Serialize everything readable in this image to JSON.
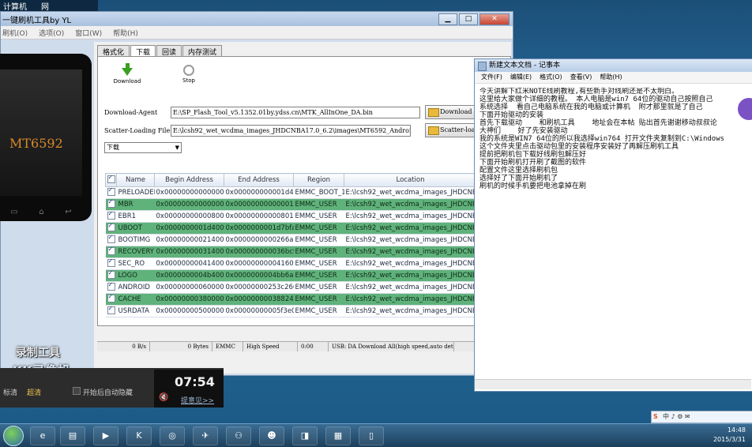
{
  "left_top_menu": [
    "计算机",
    "网"
  ],
  "flash_tool": {
    "title": "一键刷机工具by YL",
    "menu": [
      "刷机(O)",
      "选项(O)",
      "窗口(W)",
      "帮助(H)"
    ],
    "tabs": [
      "格式化",
      "下载",
      "回读",
      "内存测试"
    ],
    "active_tab": "下载",
    "download_btn": "Download",
    "stop_btn": "Stop",
    "download_agent_label": "Download-Agent",
    "download_agent_path": "E:\\SP_Flash_Tool_v5.1352.01by.ydss.cn\\MTK_AllInOne_DA.bin",
    "download_agent_btn": "Download Agent",
    "scatter_label": "Scatter-Loading File",
    "scatter_path": "E:\\lcsh92_wet_wcdma_images_JHDCNBA17.0_6.2\\images\\MT6592_Android_scatter.txt",
    "scatter_btn": "Scatter-loading",
    "mode_select": "下载",
    "table": {
      "headers": [
        "Name",
        "Begin Address",
        "End Address",
        "Region",
        "Location"
      ],
      "rows": [
        {
          "checked": true,
          "name": "PRELOADER",
          "begin": "0x0000000000000000",
          "end": "0x000000000001d453",
          "region": "EMMC_BOOT_1",
          "location": "E:\\lcsh92_wet_wcdma_images_JHDCNBA...",
          "style": "w"
        },
        {
          "checked": true,
          "name": "MBR",
          "begin": "0x0000000000000000",
          "end": "0x00000000000001ff",
          "region": "EMMC_USER",
          "location": "E:\\lcsh92_wet_wcdma_images_JHDCNBA...",
          "style": "g"
        },
        {
          "checked": true,
          "name": "EBR1",
          "begin": "0x0000000000080000",
          "end": "0x00000000000801ff",
          "region": "EMMC_USER",
          "location": "E:\\lcsh92_wet_wcdma_images_JHDCNBA...",
          "style": "w"
        },
        {
          "checked": true,
          "name": "UBOOT",
          "begin": "0x0000000001d40000",
          "end": "0x0000000001d7bfa3",
          "region": "EMMC_USER",
          "location": "E:\\lcsh92_wet_wcdma_images_JHDCNBA...",
          "style": "g"
        },
        {
          "checked": true,
          "name": "BOOTIMG",
          "begin": "0x0000000002140000",
          "end": "0x0000000000266a7ff",
          "region": "EMMC_USER",
          "location": "E:\\lcsh92_wet_wcdma_images_JHDCNBA...",
          "style": "w"
        },
        {
          "checked": true,
          "name": "RECOVERY",
          "begin": "0x0000000003140000",
          "end": "0x000000000036bcfff",
          "region": "EMMC_USER",
          "location": "E:\\lcsh92_wet_wcdma_images_JHDCNBA...",
          "style": "g"
        },
        {
          "checked": true,
          "name": "SEC_RO",
          "begin": "0x0000000004140000",
          "end": "0x00000000004160fff",
          "region": "EMMC_USER",
          "location": "E:\\lcsh92_wet_wcdma_images_JHDCNBA...",
          "style": "w"
        },
        {
          "checked": true,
          "name": "LOGO",
          "begin": "0x0000000004b40000",
          "end": "0x0000000004bb6a91",
          "region": "EMMC_USER",
          "location": "E:\\lcsh92_wet_wcdma_images_JHDCNBA...",
          "style": "g"
        },
        {
          "checked": true,
          "name": "ANDROID",
          "begin": "0x0000000006000000",
          "end": "0x00000000253c2663",
          "region": "EMMC_USER",
          "location": "E:\\lcsh92_wet_wcdma_images_JHDCNBA...",
          "style": "w"
        },
        {
          "checked": true,
          "name": "CACHE",
          "begin": "0x0000000038000000",
          "end": "0x000000000388240e7",
          "region": "EMMC_USER",
          "location": "E:\\lcsh92_wet_wcdma_images_JHDCNBA...",
          "style": "g"
        },
        {
          "checked": true,
          "name": "USRDATA",
          "begin": "0x0000000050000000",
          "end": "0x00000000005f3e0333",
          "region": "EMMC_USER",
          "location": "E:\\lcsh92_wet_wcdma_images_JHDCNBA...",
          "style": "w"
        }
      ]
    },
    "status": [
      "0 B/s",
      "0 Bytes",
      "EMMC",
      "High Speed",
      "0:00",
      "USB: DA Download All(high speed,auto detect)"
    ]
  },
  "phone": {
    "model_text": "MT6592"
  },
  "recorder": {
    "logo_line1": "录制工具",
    "logo_line2": "KK录像机",
    "label_a": "标清",
    "label_b": "超清",
    "checkbox_label": "开始后自动隐藏",
    "time": "07:54",
    "hint": "提意见>>"
  },
  "notepad": {
    "title": "新建文本文档 - 记事本",
    "menu": [
      "文件(F)",
      "编辑(E)",
      "格式(O)",
      "查看(V)",
      "帮助(H)"
    ],
    "text": "今天讲解下红米NOTE线刷教程,有些新手对线刷还是不太明白。\n这里给大家做个详细的教程。 本人电脑是win7 64位的驱动自己按照自己\n系统选择  看自己电脑系统在我的电脑或计算机  附才那里就是了自己\n下面开始驱动的安装\n首先下载驱动    和刷机工具    地址会在本帖 贴出首先谢谢移动叔叔论\n大神们    好了先安装驱动\n我的系统是WIN7 64位的所以我选择win764 打开文件夹复制到C:\\Windows\n这个文件夹里点击驱动包里的安装程序安装好了再解压刷机工具\n提前把刷机包下载好线刷包解压好\n下面开始刷机打开刷了截图的软件\n配置文件这里选择刷机包\n选择好了下面开始刷机了\n刷机的时候手机要把电池拿掉在刷"
  },
  "taskbar": {
    "time": "14:48",
    "date": "2015/3/31",
    "ime": "中 ♪ ⚙ ✉"
  }
}
